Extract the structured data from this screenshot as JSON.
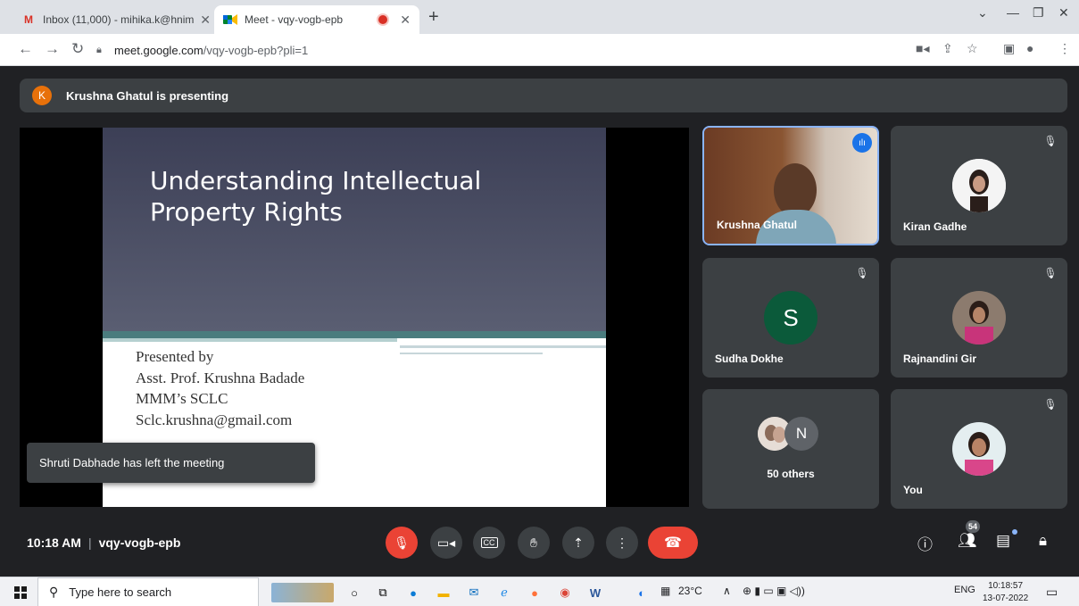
{
  "browser": {
    "tabs": [
      {
        "title": "Inbox (11,000) - mihika.k@hnim",
        "icon": "gmail-icon"
      },
      {
        "title": "Meet - vqy-vogb-epb",
        "icon": "meet-icon"
      }
    ],
    "url_host": "meet.google.com",
    "url_path": "/vqy-vogb-epb?pli=1"
  },
  "meeting": {
    "presenting_initial": "K",
    "presenting_banner": "Krushna Ghatul is presenting",
    "time": "10:18 AM",
    "code": "vqy-vogb-epb",
    "toast": "Shruti Dabhade has left the meeting",
    "people_count": "54"
  },
  "slide": {
    "title": "Understanding Intellectual Property Rights",
    "lines": [
      "Presented by",
      "Asst. Prof. Krushna Badade",
      "MMM’s SCLC",
      "Sclc.krushna@gmail.com"
    ]
  },
  "participants": {
    "tile1": "Krushna Ghatul",
    "tile2": "Kiran Gadhe",
    "tile3": "Sudha Dokhe",
    "tile3_initial": "S",
    "tile4": "Rajnandini Gir",
    "others_initial": "N",
    "others_label": "50 others",
    "self": "You"
  },
  "taskbar": {
    "search_placeholder": "Type here to search",
    "weather": "23°C",
    "lang": "ENG",
    "clock_time": "10:18:57",
    "clock_date": "13-07-2022"
  },
  "colors": {
    "meet_bg": "#202124",
    "tile_bg": "#3c4043",
    "leave_red": "#ea4335",
    "speaking_blue": "#8ab4f8"
  }
}
